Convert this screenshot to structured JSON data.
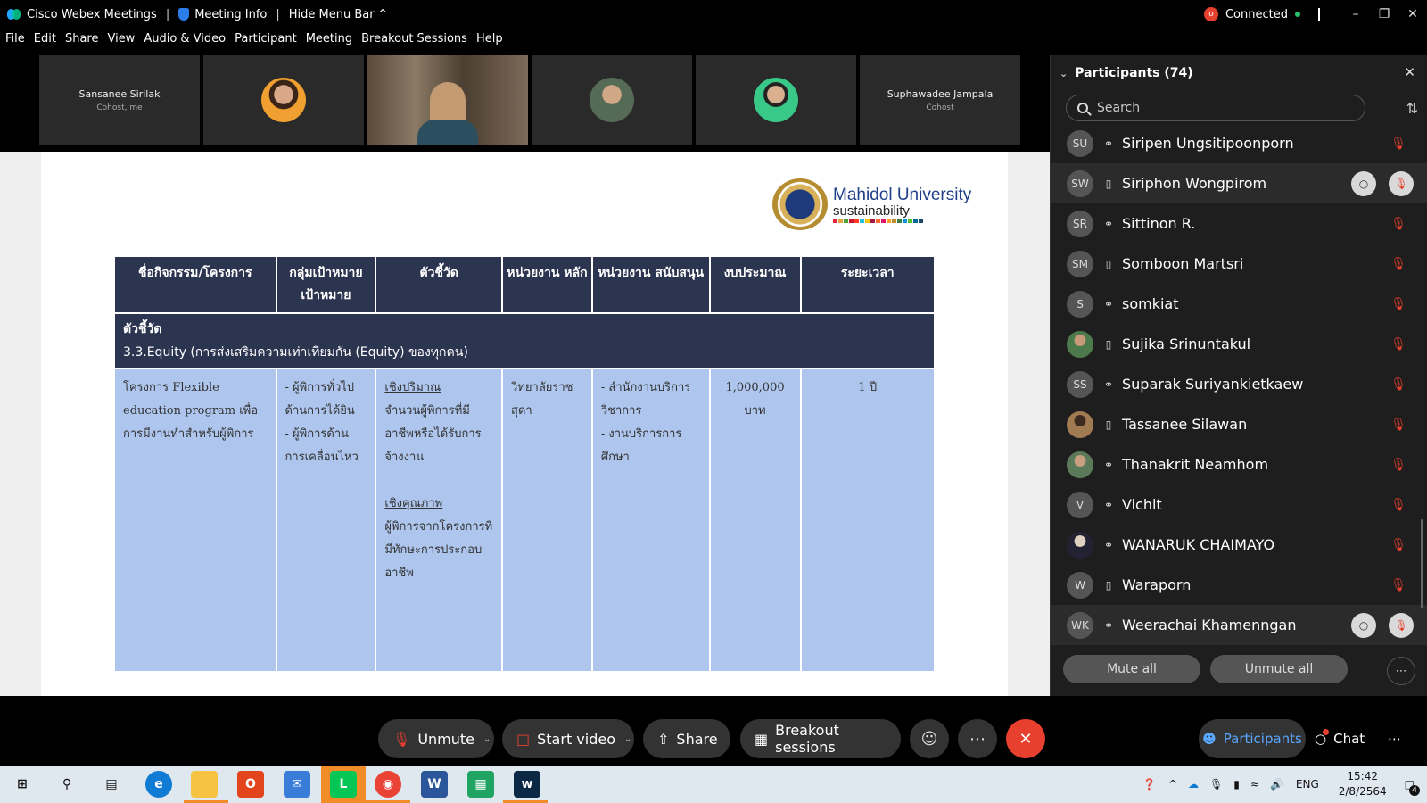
{
  "titlebar": {
    "app_title": "Cisco Webex Meetings",
    "sep": "|",
    "meeting_info": "Meeting Info",
    "hide_menu": "Hide Menu Bar ^",
    "rec_badge": "o",
    "status": "Connected",
    "status_color": "#29c36a"
  },
  "menu": [
    "File",
    "Edit",
    "Share",
    "View",
    "Audio & Video",
    "Participant",
    "Meeting",
    "Breakout Sessions",
    "Help"
  ],
  "strip": [
    {
      "name": "Sansanee Sirilak",
      "sub": "Cohost, me"
    },
    {
      "name": "",
      "sub": ""
    },
    {
      "name": "",
      "sub": ""
    },
    {
      "name": "",
      "sub": ""
    },
    {
      "name": "",
      "sub": ""
    },
    {
      "name": "Suphawadee Jampala",
      "sub": "Cohost"
    }
  ],
  "slide": {
    "logo_line1": "Mahidol University",
    "logo_line2": "sustainability",
    "headers": [
      "ชื่อกิจกรรม/โครงการ",
      "กลุ่มเป้าหมาย เป้าหมาย",
      "ตัวชี้วัด",
      "หน่วยงาน หลัก",
      "หน่วยงาน สนับสนุน",
      "งบประมาณ",
      "ระยะเวลา"
    ],
    "section_line1": "ตัวชี้วัด",
    "section_line2": "3.3.Equity (การส่งเสริมความเท่าเทียมกัน (Equity) ของทุกคน)",
    "row": {
      "project": "โครงการ Flexible education program เพื่อการมีงานทำสำหรับผู้พิการ",
      "target_1": "- ผู้พิการทั่วไป ด้านการได้ยิน",
      "target_2": "- ผู้พิการด้าน การเคลื่อนไหว",
      "kpi_quant_title": "เชิงปริมาณ",
      "kpi_quant": "จำนวนผู้พิการที่มีอาชีพหรือได้รับการจ้างงาน",
      "kpi_qual_title": "เชิงคุณภาพ",
      "kpi_qual": "ผู้พิการจากโครงการที่มีทักษะการประกอบอาชีพ",
      "main_unit": "วิทยาลัยราชสุดา",
      "support_1": "- สำนักงานบริการวิชาการ",
      "support_2": "- งานบริการการศึกษา",
      "budget": "1,000,000 บาท",
      "duration": "1 ปี"
    }
  },
  "panel": {
    "title": "Participants (74)",
    "search_placeholder": "Search",
    "participants": [
      {
        "initials": "SU",
        "name": "Siripen Ungsitipoonporn",
        "device": "headset"
      },
      {
        "initials": "SW",
        "name": "Siriphon Wongpirom",
        "device": "phone"
      },
      {
        "initials": "SR",
        "name": "Sittinon R.",
        "device": "headset"
      },
      {
        "initials": "SM",
        "name": "Somboon Martsri",
        "device": "phone"
      },
      {
        "initials": "S",
        "name": "somkiat",
        "device": "headset"
      },
      {
        "initials": "",
        "name": "Sujika Srinuntakul",
        "device": "phone"
      },
      {
        "initials": "SS",
        "name": "Suparak Suriyankietkaew",
        "device": "headset"
      },
      {
        "initials": "",
        "name": "Tassanee Silawan",
        "device": "phone"
      },
      {
        "initials": "",
        "name": "Thanakrit Neamhom",
        "device": "headset"
      },
      {
        "initials": "V",
        "name": "Vichit",
        "device": "headset"
      },
      {
        "initials": "",
        "name": "WANARUK CHAIMAYO",
        "device": "headset"
      },
      {
        "initials": "W",
        "name": "Waraporn",
        "device": "phone"
      },
      {
        "initials": "WK",
        "name": "Weerachai Khamenngan",
        "device": "headset"
      }
    ],
    "mute_all": "Mute all",
    "unmute_all": "Unmute all"
  },
  "controls": {
    "unmute": "Unmute",
    "start_video": "Start video",
    "share": "Share",
    "breakout": "Breakout sessions",
    "participants": "Participants",
    "chat": "Chat",
    "accent": "#e8402f"
  },
  "taskbar": {
    "lang": "ENG",
    "time": "15:42",
    "date": "2/8/2564",
    "notif_count": "4"
  }
}
